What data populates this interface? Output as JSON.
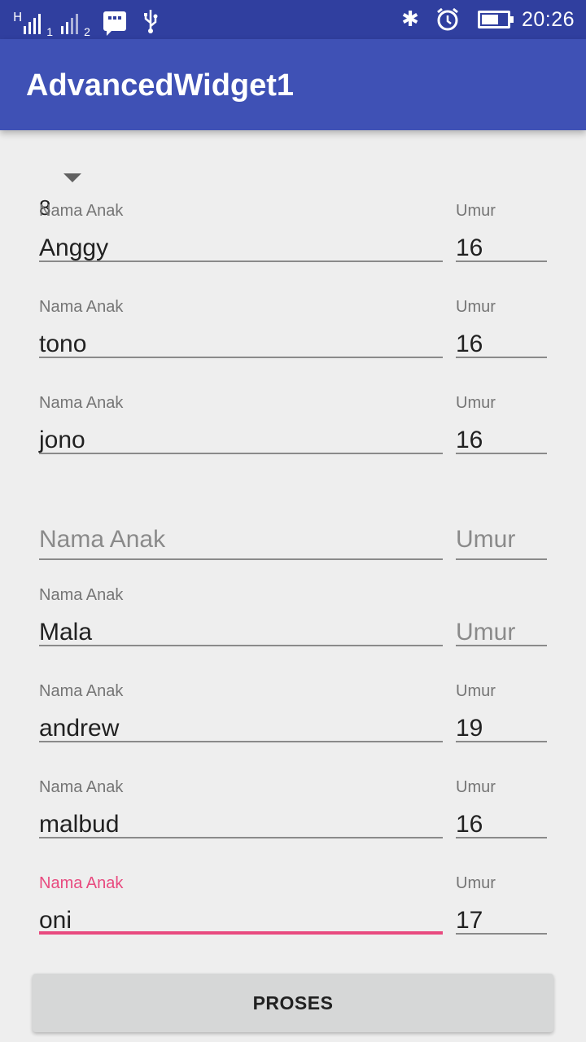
{
  "status_bar": {
    "network_type": "H",
    "sim1": "1",
    "sim2": "2",
    "icons": [
      "signal-icon",
      "bbm-icon",
      "usb-icon",
      "bluetooth-icon",
      "alarm-icon",
      "battery-charging-icon"
    ],
    "time": "20:26"
  },
  "app_bar": {
    "title": "AdvancedWidget1"
  },
  "spinner": {
    "value": "8"
  },
  "rows": [
    {
      "name_label": "Nama Anak",
      "name": "Anggy",
      "age_label": "Umur",
      "age": "16"
    },
    {
      "name_label": "Nama Anak",
      "name": "tono",
      "age_label": "Umur",
      "age": "16"
    },
    {
      "name_label": "Nama Anak",
      "name": "jono",
      "age_label": "Umur",
      "age": "16"
    },
    {
      "name_placeholder": "Nama Anak",
      "age_placeholder": "Umur"
    },
    {
      "name_label": "Nama Anak",
      "name": "Mala",
      "age_placeholder": "Umur"
    },
    {
      "name_label": "Nama Anak",
      "name": "andrew",
      "age_label": "Umur",
      "age": "19"
    },
    {
      "name_label": "Nama Anak",
      "name": "malbud",
      "age_label": "Umur",
      "age": "16"
    },
    {
      "name_label": "Nama Anak",
      "name": "oni",
      "age_label": "Umur",
      "age": "17"
    }
  ],
  "focus_color": "#e84a7f",
  "primary_color": "#3f51b5",
  "primary_dark_color": "#303f9f",
  "button": {
    "label": "PROSES"
  }
}
